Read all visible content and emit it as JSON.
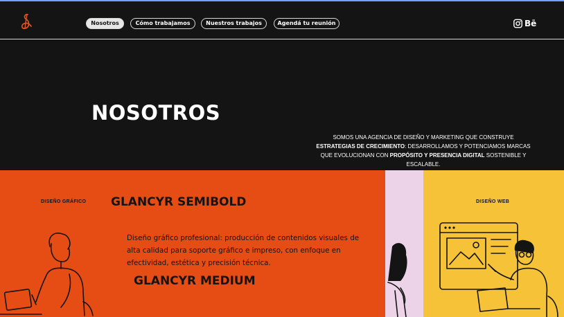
{
  "nav": {
    "items": [
      {
        "label": "Nosotros",
        "active": true
      },
      {
        "label": "Cómo trabajamos",
        "active": false
      },
      {
        "label": "Nuestros trabajos",
        "active": false
      },
      {
        "label": "Agendá tu reunión",
        "active": false
      }
    ],
    "social": [
      {
        "icon": "instagram-icon"
      },
      {
        "icon": "behance-icon",
        "label": "Bē"
      }
    ]
  },
  "hero": {
    "title": "NOSOTROS",
    "text_parts": [
      "Somos una agencia de diseño y marketing que construye ",
      "estrategias de crecimiento",
      ": desarrollamos y potenciamos marcas que evolucionan con ",
      "propósito y presencia digital",
      " sostenible y escalable."
    ]
  },
  "services": {
    "graphic": {
      "label": "Diseño gráfico",
      "heading_primary": "GLANCYR SEMIBOLD",
      "description": "Diseño gráfico profesional: producción de contenidos visuales de alta calidad para soporte gráfico e impreso, con enfoque en efectividad, estética y precisión técnica.",
      "heading_secondary": "GLANCYR MEDIUM"
    },
    "web": {
      "label": "Diseño web"
    }
  },
  "colors": {
    "background_dark": "#141414",
    "orange": "#e64d14",
    "pink": "#ecd3e8",
    "yellow": "#f6c338",
    "logo_accent": "#e8541c",
    "top_accent": "#6fa1ff"
  }
}
